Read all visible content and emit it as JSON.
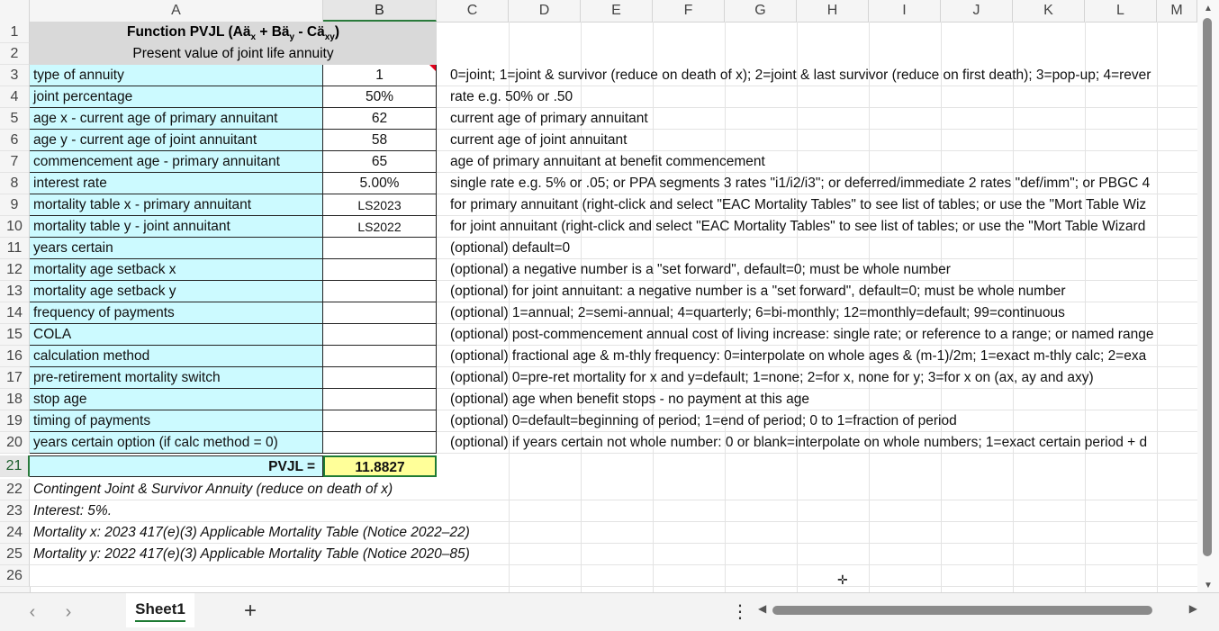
{
  "columns": [
    "A",
    "B",
    "C",
    "D",
    "E",
    "F",
    "G",
    "H",
    "I",
    "J",
    "K",
    "L",
    "M"
  ],
  "title_row": {
    "label": "Function PVJL (Aä",
    "sub_x": "x",
    "plus": " + Bä",
    "sub_y": "y",
    "minus": " - Cä",
    "sub_xy": "xy",
    "close": ")"
  },
  "subtitle": "Present value of joint life annuity",
  "rows": [
    {
      "num": "3",
      "label": "type of annuity",
      "value": "1",
      "note": "0=joint; 1=joint & survivor (reduce on death of x); 2=joint & last survivor (reduce on first death); 3=pop-up; 4=rever"
    },
    {
      "num": "4",
      "label": "joint percentage",
      "value": "50%",
      "note": "rate e.g. 50% or .50"
    },
    {
      "num": "5",
      "label": "age x - current age of primary annuitant",
      "value": "62",
      "note": "current age of primary annuitant"
    },
    {
      "num": "6",
      "label": "age y - current age of joint annuitant",
      "value": "58",
      "note": "current age of joint annuitant"
    },
    {
      "num": "7",
      "label": "commencement age - primary annuitant",
      "value": "65",
      "note": "age of primary annuitant at benefit commencement"
    },
    {
      "num": "8",
      "label": "interest rate",
      "value": "5.00%",
      "note": "single rate e.g. 5% or .05; or PPA segments 3 rates \"i1/i2/i3\"; or deferred/immediate 2 rates \"def/imm\"; or PBGC 4"
    },
    {
      "num": "9",
      "label": "mortality table x - primary annuitant",
      "value": "LS2023",
      "note": "for primary annuitant (right-click and select \"EAC Mortality Tables\" to see list of tables; or use the \"Mort Table Wiz"
    },
    {
      "num": "10",
      "label": "mortality table y - joint annuitant",
      "value": "LS2022",
      "note": "for joint annuitant (right-click and select \"EAC Mortality Tables\" to see list of tables; or use the \"Mort Table Wizard"
    },
    {
      "num": "11",
      "label": "years certain",
      "value": "",
      "note": "(optional) default=0"
    },
    {
      "num": "12",
      "label": "mortality age setback x",
      "value": "",
      "note": "(optional) a negative number is a \"set forward\", default=0; must be whole number"
    },
    {
      "num": "13",
      "label": "mortality age setback y",
      "value": "",
      "note": "(optional) for joint annuitant: a negative number is a \"set forward\", default=0; must be whole number"
    },
    {
      "num": "14",
      "label": "frequency of payments",
      "value": "",
      "note": "(optional) 1=annual; 2=semi-annual; 4=quarterly; 6=bi-monthly; 12=monthly=default; 99=continuous"
    },
    {
      "num": "15",
      "label": "COLA",
      "value": "",
      "note": "(optional) post-commencement annual cost of living increase: single rate; or reference to a range; or named range"
    },
    {
      "num": "16",
      "label": "calculation method",
      "value": "",
      "note": "(optional) fractional age & m-thly frequency: 0=interpolate on whole ages & (m-1)/2m; 1=exact m-thly calc; 2=exa"
    },
    {
      "num": "17",
      "label": "pre-retirement mortality switch",
      "value": "",
      "note": "(optional) 0=pre-ret mortality for x and y=default; 1=none; 2=for x, none for y; 3=for x on (ax, ay and axy)"
    },
    {
      "num": "18",
      "label": "stop age",
      "value": "",
      "note": "(optional) age when benefit stops - no payment at this age"
    },
    {
      "num": "19",
      "label": "timing of payments",
      "value": "",
      "note": "(optional) 0=default=beginning of period; 1=end of period; 0 to 1=fraction of period"
    },
    {
      "num": "20",
      "label": "years certain option (if calc method = 0)",
      "value": "",
      "note": "(optional) if years certain not whole number: 0 or blank=interpolate on whole numbers; 1=exact certain period + d"
    }
  ],
  "result": {
    "num": "21",
    "label": "PVJL =",
    "value": "11.8827"
  },
  "notes": [
    {
      "num": "22",
      "text": "Contingent Joint & Survivor Annuity (reduce on death of x)"
    },
    {
      "num": "23",
      "text": "Interest:  5%."
    },
    {
      "num": "24",
      "text": "Mortality x: 2023 417(e)(3) Applicable Mortality Table (Notice 2022–22)"
    },
    {
      "num": "25",
      "text": "Mortality y: 2022 417(e)(3) Applicable Mortality Table (Notice 2020–85)"
    },
    {
      "num": "26",
      "text": ""
    }
  ],
  "row_nums_top": [
    "1",
    "2"
  ],
  "sheet_tab": "Sheet1",
  "icons": {
    "prev_sheet": "chevron-left-icon",
    "next_sheet": "chevron-right-icon",
    "add_sheet": "plus-icon",
    "more": "more-vertical-icon",
    "cursor": "cell-cursor-icon"
  },
  "colors": {
    "input_fill": "#ccfaff",
    "result_fill": "#ffff99",
    "header_fill": "#d9d9d9",
    "selection_accent": "#1e7b34"
  }
}
